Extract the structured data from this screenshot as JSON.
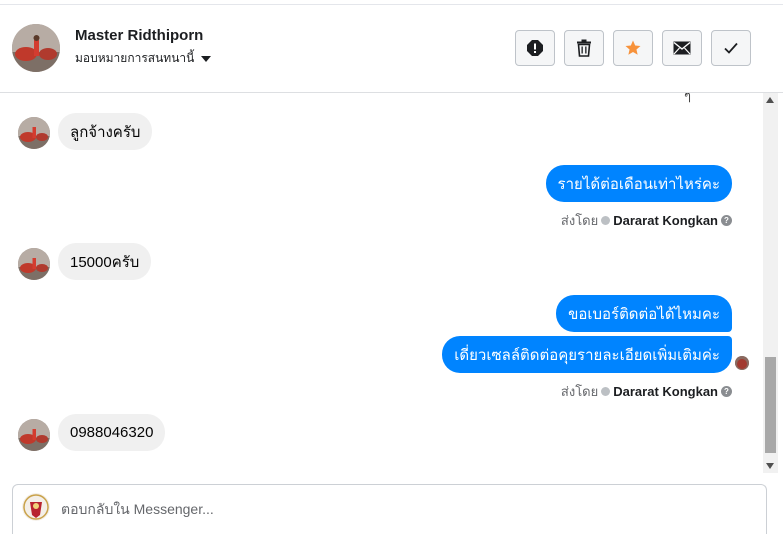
{
  "header": {
    "name": "Master Ridthiporn",
    "assign_label": "มอบหมายการสนทนานี้",
    "actions": [
      {
        "icon": "exclamation-icon",
        "name": "mark-spam-button"
      },
      {
        "icon": "trash-icon",
        "name": "delete-button"
      },
      {
        "icon": "star-icon",
        "name": "star-button"
      },
      {
        "icon": "envelope-icon",
        "name": "mark-unread-button"
      },
      {
        "icon": "checkmark-icon",
        "name": "mark-done-button"
      }
    ]
  },
  "thread": {
    "partial_text": "ๆ",
    "messages": [
      {
        "from": "customer",
        "text": "ลูกจ้างครับ"
      },
      {
        "from": "page",
        "text": "รายได้ต่อเดือนเท่าไหร่คะ"
      },
      {
        "from": "customer",
        "text": "15000ครับ"
      },
      {
        "from": "page",
        "text": "ขอเบอร์ติดต่อได้ไหมคะ"
      },
      {
        "from": "page",
        "text": "เดี่ยวเซลล์ติดต่อคุยรายละเอียดเพิ่มเติมค่ะ"
      },
      {
        "from": "customer",
        "text": "0988046320"
      }
    ],
    "sent_by": [
      {
        "prefix": "ส่งโดย",
        "name": "Dararat Kongkan"
      },
      {
        "prefix": "ส่งโดย",
        "name": "Dararat Kongkan"
      }
    ]
  },
  "composer": {
    "placeholder": "ตอบกลับใน Messenger..."
  },
  "colors": {
    "outgoing_bubble": "#0084ff",
    "incoming_bubble": "#f0f0f0",
    "star": "#f7923b"
  }
}
